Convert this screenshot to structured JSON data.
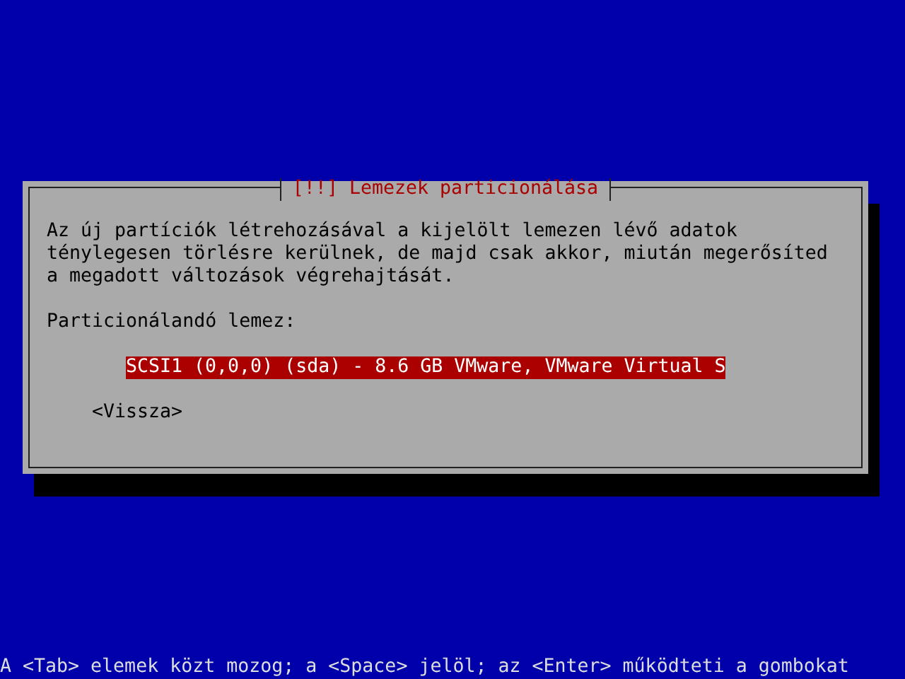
{
  "dialog": {
    "title": "[!!] Lemezek particionálása",
    "message": [
      "Az új partíciók létrehozásával a kijelölt lemezen lévő adatok",
      "ténylegesen törlésre kerülnek, de majd csak akkor, miután megerősíted",
      "a megadott változások végrehajtását."
    ],
    "prompt": "Particionálandó lemez:",
    "items": [
      {
        "label": "SCSI1 (0,0,0) (sda) - 8.6 GB VMware, VMware Virtual S",
        "selected": true
      }
    ],
    "back_button": "<Vissza>"
  },
  "help_line": "A <Tab> elemek közt mozog; a <Space> jelöl; az <Enter> működteti a gombokat"
}
